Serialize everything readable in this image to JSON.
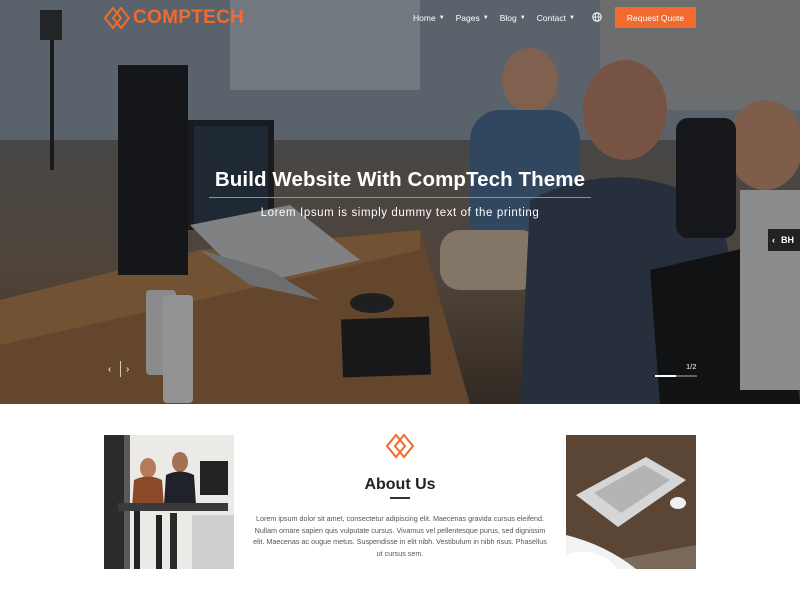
{
  "brand": {
    "name_part1": "COMP",
    "name_part2": "TECH",
    "accent": "#f26a2e"
  },
  "nav": {
    "items": [
      {
        "label": "Home",
        "has_dropdown": true
      },
      {
        "label": "Pages",
        "has_dropdown": true
      },
      {
        "label": "Blog",
        "has_dropdown": true
      },
      {
        "label": "Contact",
        "has_dropdown": true
      }
    ],
    "icons": [
      "globe-icon",
      "search-icon"
    ],
    "cta_label": "Request Quote"
  },
  "hero": {
    "title": "Build Website With CompTech Theme",
    "subtitle": "Lorem Ipsum is simply dummy text of the printing",
    "prev_glyph": "‹",
    "next_glyph": "›",
    "slide_counter": "1/2",
    "slide_progress": 0.5,
    "side_tab_label": "BH"
  },
  "about": {
    "title": "About Us",
    "body": "Lorem ipsum dolor sit amet, consectetur adipiscing elit. Maecenas gravida cursus eleifend. Nullam ornare sapien quis vulputate cursus. Vivamus vel pellentesque purus, sed dignissim elit. Maecenas ac ougue metus. Suspendisse in elit nibh. Vestibulum in nibh risus. Phasellus ut cursus sem."
  }
}
